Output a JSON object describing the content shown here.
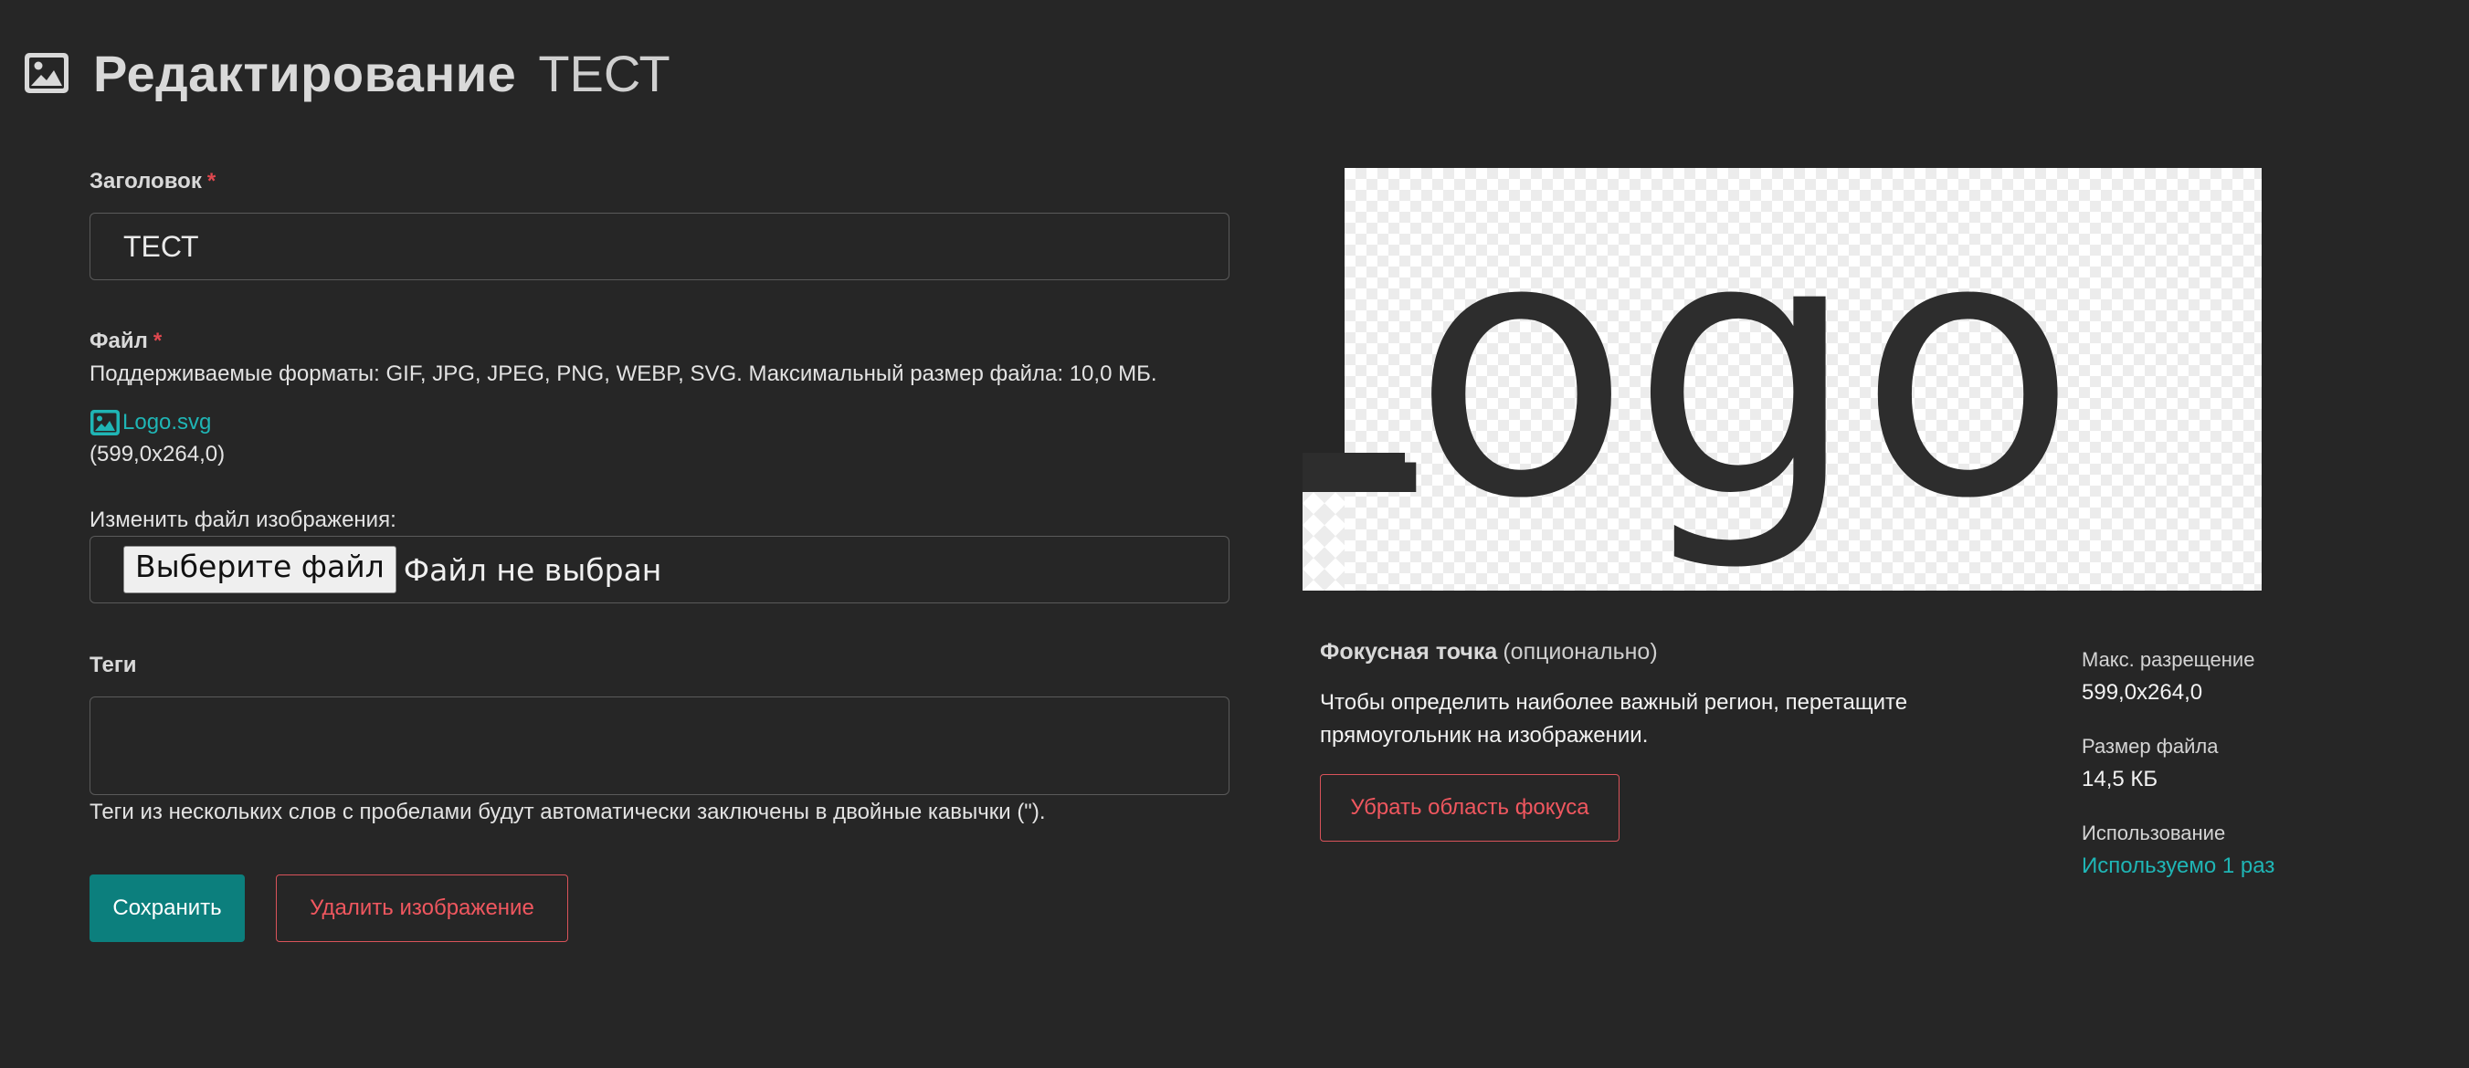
{
  "header": {
    "title": "Редактирование",
    "subtitle": "ТЕСТ",
    "icon": "image-icon"
  },
  "form": {
    "title_field": {
      "label": "Заголовок",
      "required_mark": "*",
      "value": "ТЕСТ"
    },
    "file_field": {
      "label": "Файл",
      "required_mark": "*",
      "help": "Поддерживаемые форматы: GIF, JPG, JPEG, PNG, WEBP, SVG. Максимальный размер файла: 10,0 МБ.",
      "current_file_name": "Logo.svg",
      "current_file_icon": "image-icon",
      "current_file_dimensions": "(599,0x264,0)"
    },
    "change_file": {
      "label": "Изменить файл изображения:",
      "choose_button": "Выберите файл",
      "no_file_text": "Файл не выбран"
    },
    "tags_field": {
      "label": "Теги",
      "value": "",
      "help": "Теги из нескольких слов с пробелами будут автоматически заключены в двойные кавычки (\")."
    },
    "actions": {
      "save": "Сохранить",
      "delete": "Удалить изображение"
    }
  },
  "preview": {
    "image_text": "Logo"
  },
  "focus": {
    "title": "Фокусная точка",
    "optional": "(опционально)",
    "description": "Чтобы определить наиболее важный регион, перетащите прямоугольник на изображении.",
    "remove_button": "Убрать область фокуса"
  },
  "meta": {
    "max_resolution_label": "Макс. разрещение",
    "max_resolution_value": "599,0x264,0",
    "file_size_label": "Размер файла",
    "file_size_value": "14,5 КБ",
    "usage_label": "Использование",
    "usage_link": "Используемо 1 раз"
  },
  "colors": {
    "background": "#262626",
    "accent": "#0c7f7d",
    "link": "#1fb5b5",
    "danger": "#f0575f",
    "required": "#e0484f"
  }
}
